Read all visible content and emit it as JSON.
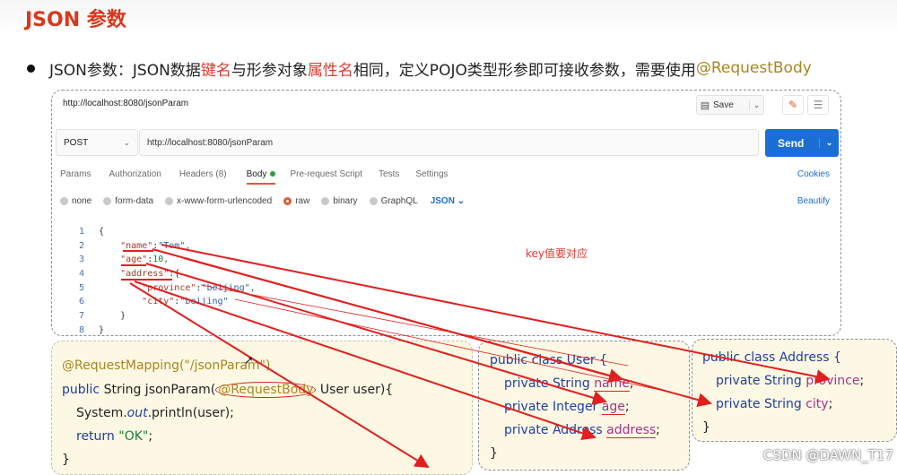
{
  "slide": {
    "title": "JSON 参数",
    "bullet": {
      "p1": "JSON参数：JSON数据",
      "p2": "键名",
      "p3": "与形参对象",
      "p4": "属性名",
      "p5": "相同，定义POJO类型形参即可接收参数，需要使用 ",
      "p6": "@RequestBody"
    }
  },
  "postman": {
    "request_title": "http://localhost:8080/jsonParam",
    "save_label": "Save",
    "method": "POST",
    "url": "http://localhost:8080/jsonParam",
    "send_label": "Send",
    "tabs": [
      "Params",
      "Authorization",
      "Headers (8)",
      "Body",
      "Pre-request Script",
      "Tests",
      "Settings"
    ],
    "active_tab": "Body",
    "cookies_label": "Cookies",
    "body_types": [
      "none",
      "form-data",
      "x-www-form-urlencoded",
      "raw",
      "binary",
      "GraphQL"
    ],
    "selected_body_type": "raw",
    "raw_format": "JSON",
    "beautify_label": "Beautify",
    "code_lines": [
      {
        "num": "1",
        "a": "{",
        "b": "",
        "c": "",
        "d": ""
      },
      {
        "num": "2",
        "a": "    ",
        "b": "\"name\"",
        "c": ":",
        "d": "\"Tom\","
      },
      {
        "num": "3",
        "a": "    ",
        "b": "\"age\"",
        "c": ":",
        "d": "10,"
      },
      {
        "num": "4",
        "a": "    ",
        "b": "\"address\"",
        "c": ":",
        "d": "{"
      },
      {
        "num": "5",
        "a": "        ",
        "b": "\"province\"",
        "c": ":",
        "d": "\"beijing\","
      },
      {
        "num": "6",
        "a": "        ",
        "b": "\"city\"",
        "c": ":",
        "d": "\"beijing\""
      },
      {
        "num": "7",
        "a": "    ",
        "b": "}",
        "c": "",
        "d": ""
      },
      {
        "num": "8",
        "a": "}",
        "b": "",
        "c": "",
        "d": ""
      }
    ],
    "annotation": "key值要对应"
  },
  "controller": {
    "annotation_line": "@RequestMapping(\"/jsonParam\")",
    "l2a": "public",
    "l2b": " String jsonParam(",
    "l2c": "@RequestBody",
    "l2d": " User user){",
    "l3a": "System.",
    "l3b": "out",
    "l3c": ".println(user);",
    "l4a": "return ",
    "l4b": "\"OK\"",
    "l4c": ";",
    "l5": "}"
  },
  "user_class": {
    "header": "public class User {",
    "fields": [
      {
        "prefix": "private String ",
        "name": "name",
        "suffix": ";"
      },
      {
        "prefix": "private Integer ",
        "name": "age",
        "suffix": ";"
      },
      {
        "prefix": "private Address ",
        "name": "address",
        "suffix": ";"
      }
    ],
    "close": "}"
  },
  "address_class": {
    "header": "public class Address {",
    "fields": [
      {
        "prefix": "private String ",
        "name": "province",
        "suffix": ";"
      },
      {
        "prefix": "private String ",
        "name": "city",
        "suffix": ";"
      }
    ],
    "close": "}"
  },
  "watermark": "CSDN @DAWN_T17",
  "colors": {
    "title_red": "#d9381e",
    "send_blue": "#1b6ed4",
    "arrow_red": "#e02020",
    "panel_yellow": "#fdf8e4"
  }
}
